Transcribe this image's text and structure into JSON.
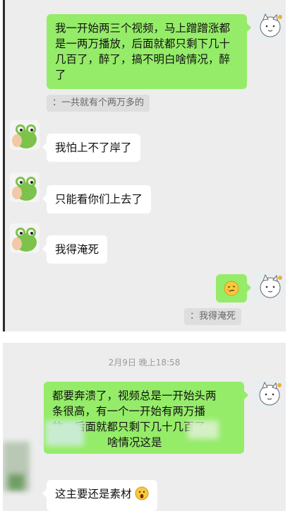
{
  "panel_top": {
    "messages": [
      {
        "side": "out",
        "avatar": "cartoon-cat-avatar",
        "text": "我一开始两三个视频，马上蹭蹭涨都是一两万播放，后面就都只剩下几十几百了，醉了，搞不明白啥情况，醉了"
      },
      {
        "side": "out",
        "quote": "：一共就有个两万多的"
      },
      {
        "side": "in",
        "avatar": "green-frog-avatar",
        "text": "我怕上不了岸了"
      },
      {
        "side": "in",
        "avatar": "green-frog-avatar",
        "text": "只能看你们上去了"
      },
      {
        "side": "in",
        "avatar": "green-frog-avatar",
        "text": "我得淹死"
      },
      {
        "side": "out",
        "avatar": "cartoon-cat-avatar",
        "emoji": "smirk-face-emoji"
      },
      {
        "side": "out",
        "quote": "：我得淹死"
      }
    ]
  },
  "panel_bottom": {
    "timestamp": "2月9日 晚上18:58",
    "messages": [
      {
        "side": "out",
        "avatar": "cartoon-cat-avatar",
        "line1": "都要奔溃了，视频总是一开始头两",
        "line2": "条很高，有一个一开始有两万播",
        "line3": "放，后面就都只剩下几十几百了",
        "line4": "啥情况这是"
      },
      {
        "side": "in",
        "text": "这主要还是素材",
        "emoji": "surprised-face-emoji"
      }
    ]
  },
  "colors": {
    "outgoing_bubble": "#95ec69",
    "incoming_bubble": "#ffffff",
    "chat_background": "#ededed",
    "quote_background": "#dedede"
  }
}
